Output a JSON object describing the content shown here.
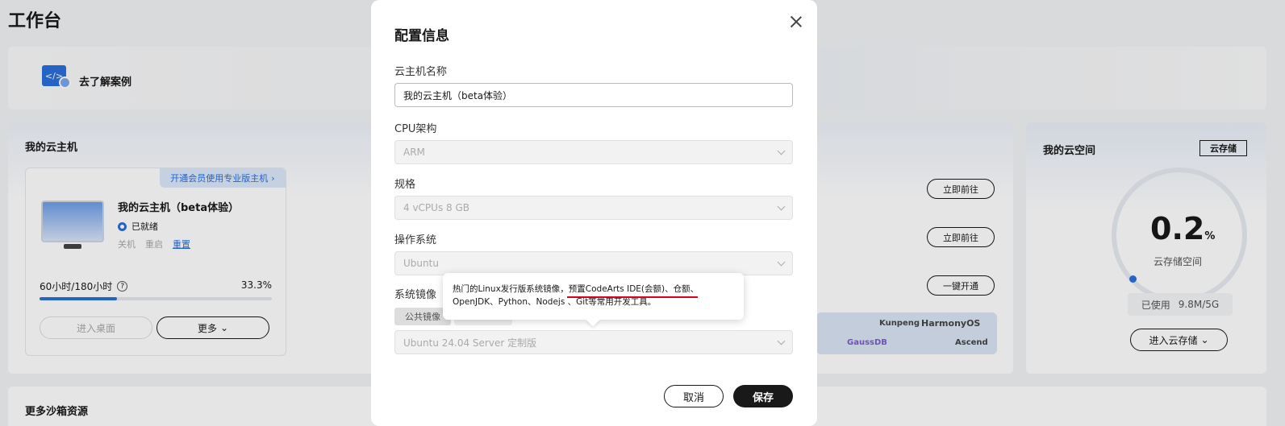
{
  "page": {
    "title": "工作台"
  },
  "banner": {
    "icon": "code-icon",
    "text": "去了解案例"
  },
  "vm_card": {
    "title": "我的云主机",
    "promo": "开通会员使用专业版主机",
    "name": "我的云主机（beta体验）",
    "status": "已就绪",
    "actions": [
      "关机",
      "重启",
      "重置"
    ],
    "usage": "60小时/180小时",
    "usage_percent": "33.3%",
    "usage_fraction": 0.333,
    "enter_desktop": "进入桌面",
    "more": "更多",
    "goto1": "立即前往",
    "goto2": "立即前往",
    "open": "一键开通",
    "logos": [
      "Kunpeng",
      "HarmonyOS",
      "GaussDB",
      "Ascend"
    ]
  },
  "space_card": {
    "title": "我的云空间",
    "tag": "云存储",
    "value": "0.2",
    "unit": "%",
    "subtitle": "云存储空间",
    "used_label": "已使用",
    "used_value": "9.8M/5G",
    "enter_storage": "进入云存储"
  },
  "sandbox": {
    "title": "更多沙箱资源"
  },
  "modal": {
    "title": "配置信息",
    "name_label": "云主机名称",
    "name_value": "我的云主机（beta体验）",
    "cpu_label": "CPU架构",
    "cpu_value": "ARM",
    "spec_label": "规格",
    "spec_value": "4 vCPUs 8 GB",
    "os_label": "操作系统",
    "os_value": "Ubuntu",
    "image_label": "系统镜像",
    "image_tab_public": "公共镜像",
    "image_value": "Ubuntu 24.04 Server 定制版",
    "cancel": "取消",
    "save": "保存"
  },
  "tooltip": {
    "line1": "热门的Linux发行版系统镜像，预置CodeArts IDE(会额)、仓额、",
    "line2": "OpenJDK、Python、Nodejs 、Git等常用开发工具。"
  },
  "colors": {
    "accent": "#2a6fdb",
    "primary_button": "#191919",
    "underline": "#e0001a"
  }
}
